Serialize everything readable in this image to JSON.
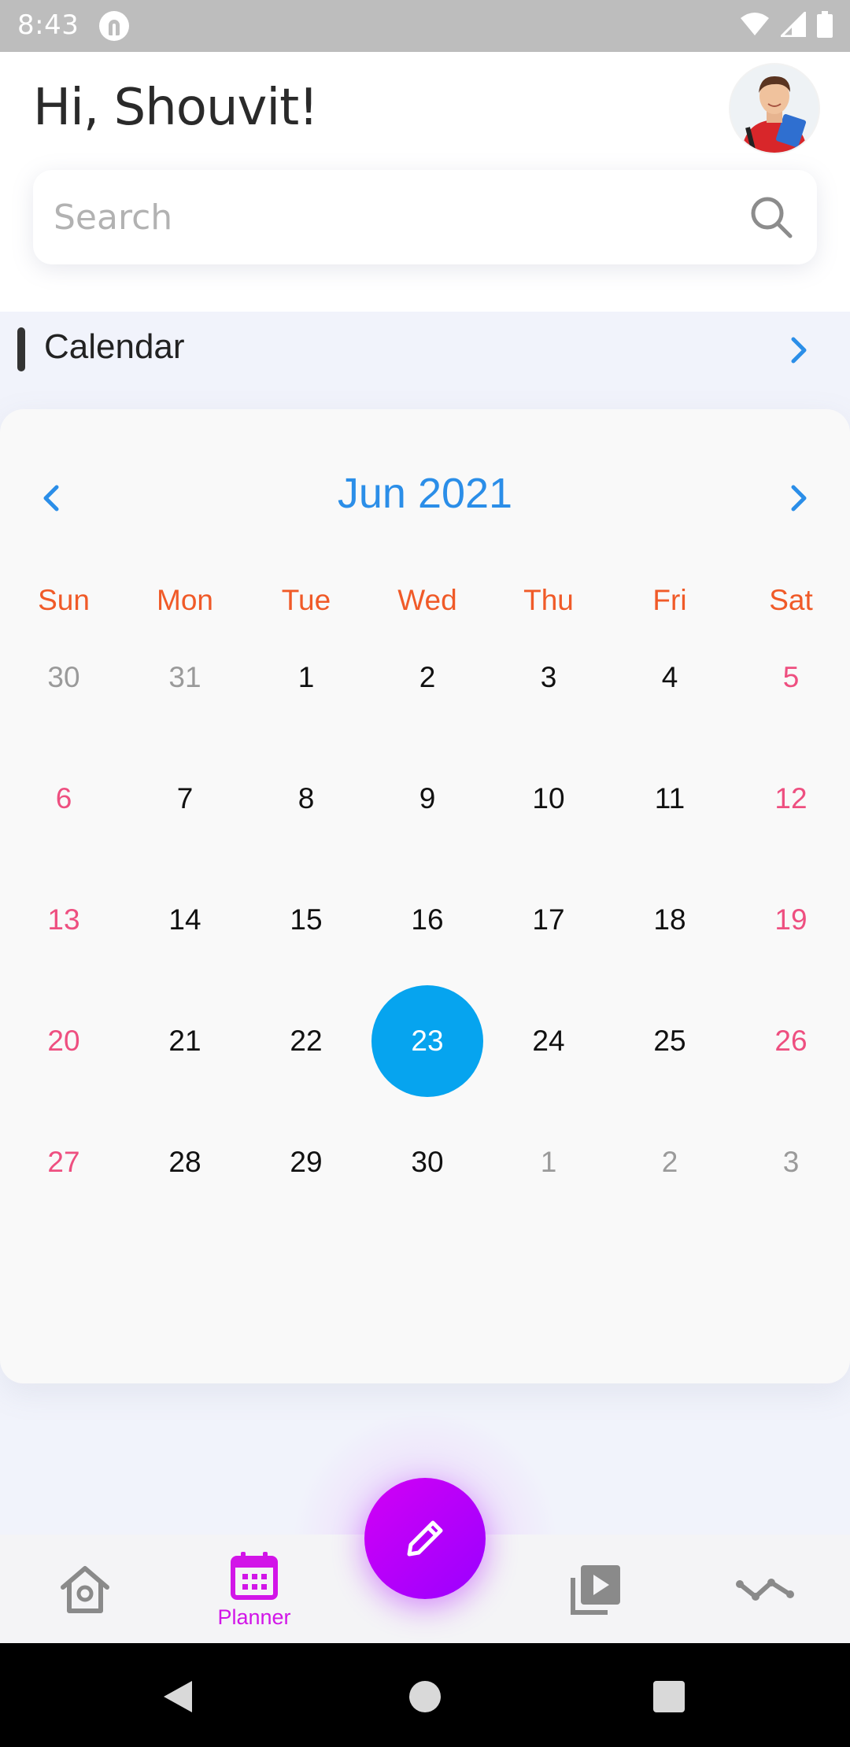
{
  "status_bar": {
    "time": "8:43",
    "app_icon": "notification-app-icon",
    "icons": [
      "wifi-icon",
      "signal-icon",
      "battery-icon"
    ]
  },
  "header": {
    "greeting": "Hi, Shouvit!",
    "avatar_icon": "user-avatar",
    "search": {
      "placeholder": "Search",
      "icon": "search-icon"
    }
  },
  "section": {
    "title": "Calendar",
    "arrow_icon": "chevron-right-icon",
    "accent_color": "#2b8ee8"
  },
  "calendar": {
    "month_label": "Jun 2021",
    "prev_icon": "chevron-left-icon",
    "next_icon": "chevron-right-icon",
    "weekdays": [
      "Sun",
      "Mon",
      "Tue",
      "Wed",
      "Thu",
      "Fri",
      "Sat"
    ],
    "weekday_color": "#f05a28",
    "weekend_color": "#ee4f80",
    "selected_color": "#06a4ef",
    "weeks": [
      [
        {
          "d": "30",
          "muted": true
        },
        {
          "d": "31",
          "muted": true
        },
        {
          "d": "1"
        },
        {
          "d": "2"
        },
        {
          "d": "3"
        },
        {
          "d": "4"
        },
        {
          "d": "5",
          "weekend": true
        }
      ],
      [
        {
          "d": "6",
          "weekend": true
        },
        {
          "d": "7"
        },
        {
          "d": "8"
        },
        {
          "d": "9"
        },
        {
          "d": "10"
        },
        {
          "d": "11"
        },
        {
          "d": "12",
          "weekend": true
        }
      ],
      [
        {
          "d": "13",
          "weekend": true
        },
        {
          "d": "14"
        },
        {
          "d": "15"
        },
        {
          "d": "16"
        },
        {
          "d": "17"
        },
        {
          "d": "18"
        },
        {
          "d": "19",
          "weekend": true
        }
      ],
      [
        {
          "d": "20",
          "weekend": true
        },
        {
          "d": "21"
        },
        {
          "d": "22"
        },
        {
          "d": "23",
          "selected": true
        },
        {
          "d": "24"
        },
        {
          "d": "25"
        },
        {
          "d": "26",
          "weekend": true
        }
      ],
      [
        {
          "d": "27",
          "weekend": true
        },
        {
          "d": "28"
        },
        {
          "d": "29"
        },
        {
          "d": "30"
        },
        {
          "d": "1",
          "muted": true
        },
        {
          "d": "2",
          "muted": true
        },
        {
          "d": "3",
          "muted": true
        }
      ]
    ]
  },
  "bottom_nav": {
    "items": [
      {
        "icon": "home-icon",
        "label": ""
      },
      {
        "icon": "calendar-icon",
        "label": "Planner",
        "active": true
      },
      {
        "icon": "video-library-icon",
        "label": ""
      },
      {
        "icon": "activity-icon",
        "label": ""
      }
    ],
    "fab_icon": "pencil-icon",
    "active_color": "#d215e8"
  },
  "android_nav": {
    "buttons": [
      "back-icon",
      "home-circle-icon",
      "recents-icon"
    ]
  }
}
